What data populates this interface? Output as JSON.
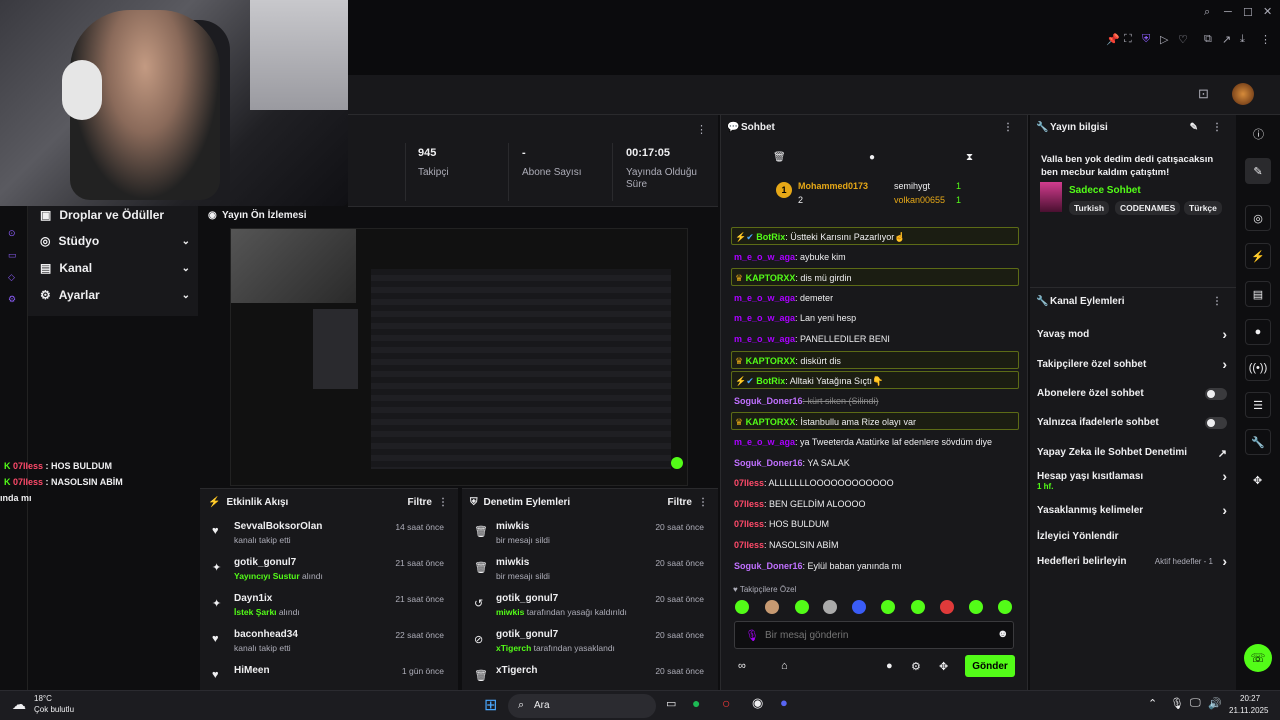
{
  "stats": [
    {
      "value": "945",
      "label": "Takipçi"
    },
    {
      "value": "-",
      "label": "Abone Sayısı"
    },
    {
      "value": "00:17:05",
      "label": "Yayında Olduğu Süre"
    }
  ],
  "leftmenu": [
    "Droplar ve Ödüller",
    "Stüdyo",
    "Kanal",
    "Ayarlar"
  ],
  "leftchat": [
    {
      "user": "07lless",
      "text": " : HOS BULDUM"
    },
    {
      "user": "07lless",
      "text": " : NASOLSIN ABİM"
    },
    {
      "user": "",
      "text": "ında mı"
    }
  ],
  "preview_title": "Yayın Ön İzlemesi",
  "activity": {
    "title": "Etkinlik Akışı",
    "filter": "Filtre",
    "rows": [
      {
        "name": "SevvalBoksorOlan",
        "desc": "kanalı takip etti",
        "hl": "",
        "time": "14 saat önce",
        "icon": "heart-icon"
      },
      {
        "name": "gotik_gonul7",
        "desc": " alındı",
        "hl": "Yayıncıyı Sustur",
        "time": "21 saat önce",
        "icon": "points-icon"
      },
      {
        "name": "Dayn1ix",
        "desc": " alındı",
        "hl": "İstek Şarkı",
        "time": "21 saat önce",
        "icon": "points-icon"
      },
      {
        "name": "baconhead34",
        "desc": "kanalı takip etti",
        "hl": "",
        "time": "22 saat önce",
        "icon": "heart-icon"
      },
      {
        "name": "HiMeen",
        "desc": "",
        "hl": "",
        "time": "1 gün önce",
        "icon": "heart-icon"
      }
    ]
  },
  "moderation": {
    "title": "Denetim Eylemleri",
    "filter": "Filtre",
    "rows": [
      {
        "name": "miwkis",
        "hl": "",
        "desc": "bir mesajı sildi",
        "time": "20 saat önce",
        "icon": "trash-icon"
      },
      {
        "name": "miwkis",
        "hl": "",
        "desc": "bir mesajı sildi",
        "time": "20 saat önce",
        "icon": "trash-icon"
      },
      {
        "name": "gotik_gonul7",
        "hl": "miwkis",
        "desc": " tarafından yasağı kaldırıldı",
        "time": "20 saat önce",
        "icon": "undo-icon"
      },
      {
        "name": "gotik_gonul7",
        "hl": "xTigerch",
        "desc": " tarafından yasaklandı",
        "time": "20 saat önce",
        "icon": "ban-icon"
      },
      {
        "name": "xTigerch",
        "hl": "",
        "desc": "",
        "time": "20 saat önce",
        "icon": "trash-icon"
      }
    ]
  },
  "chat": {
    "title": "Sohbet",
    "leaderboard": [
      {
        "name": "Mohammed0173",
        "count": "2"
      },
      {
        "name": "semihygt",
        "count": "1"
      },
      {
        "name": "volkan00655",
        "count": "1"
      }
    ],
    "messages": [
      {
        "user": "BotRix",
        "text": ": Üstteki Karısını Pazarlıyor☝",
        "color": "#53fc18",
        "hl": true
      },
      {
        "user": "m_e_o_w_aga",
        "text": ": aybuke kim",
        "color": "#a900ff",
        "hl": false
      },
      {
        "user": "KAPTORXX",
        "text": ": dis      mü girdin",
        "color": "#53fc18",
        "hl": true
      },
      {
        "user": "m_e_o_w_aga",
        "text": ": demeter",
        "color": "#a900ff",
        "hl": false
      },
      {
        "user": "m_e_o_w_aga",
        "text": ": Lan yeni hesp",
        "color": "#a900ff",
        "hl": false
      },
      {
        "user": "m_e_o_w_aga",
        "text": ": PANELLEDILER BENI",
        "color": "#a900ff",
        "hl": false
      },
      {
        "user": "KAPTORXX",
        "text": ": diskürt dis",
        "color": "#53fc18",
        "hl": true
      },
      {
        "user": "BotRix",
        "text": ": Alltaki Yatağına Sıçtı👇",
        "color": "#53fc18",
        "hl": true
      },
      {
        "user": "Soguk_Doner16",
        "text": ": kürt siken (Silindi)",
        "color": "#c070ff",
        "hl": false
      },
      {
        "user": "KAPTORXX",
        "text": ":      İstanbullu ama Rize olayı var",
        "color": "#53fc18",
        "hl": true
      },
      {
        "user": "m_e_o_w_aga",
        "text": ": ya Tweeterda Atatürke laf edenlere sövdüm diye",
        "color": "#a900ff",
        "hl": false
      },
      {
        "user": "Soguk_Doner16",
        "text": ": YA SALAK",
        "color": "#c070ff",
        "hl": false
      },
      {
        "user": "07lless",
        "text": ": ALLLLLLLOOOOOOOOOOOO",
        "color": "#ff4a6a",
        "hl": false
      },
      {
        "user": "07lless",
        "text": ": BEN GELDİM ALOOOO",
        "color": "#ff4a6a",
        "hl": false
      },
      {
        "user": "07lless",
        "text": ": HOS BULDUM",
        "color": "#ff4a6a",
        "hl": false
      },
      {
        "user": "07lless",
        "text": ": NASOLSIN ABİM",
        "color": "#ff4a6a",
        "hl": false
      },
      {
        "user": "Soguk_Doner16",
        "text": ": Eylül baban yanında mı",
        "color": "#c070ff",
        "hl": false
      }
    ],
    "followers_only": "Takipçilere Özel",
    "input_placeholder": "Bir mesaj gönderin",
    "send": "Gönder"
  },
  "stream_info": {
    "title": "Yayın bilgisi",
    "stream_title": "Valla ben yok dedim dedi çatışacaksın ben mecbur kaldım çatıştım!",
    "category": "Sadece Sohbet",
    "tags": [
      "Turkish",
      "CODENAMES",
      "Türkçe"
    ]
  },
  "channel_actions": {
    "title": "Kanal Eylemleri",
    "items": [
      {
        "label": "Yavaş mod",
        "type": "arrow"
      },
      {
        "label": "Takipçilere özel sohbet",
        "type": "arrow"
      },
      {
        "label": "Abonelere özel sohbet",
        "type": "toggle"
      },
      {
        "label": "Yalnızca ifadelerle sohbet",
        "type": "toggle"
      },
      {
        "label": "Yapay Zeka ile Sohbet Denetimi",
        "type": "ext"
      },
      {
        "label": "Hesap yaşı kısıtlaması",
        "type": "arrow",
        "sub": "1 hf."
      },
      {
        "label": "Yasaklanmış kelimeler",
        "type": "arrow"
      },
      {
        "label": "İzleyici Yönlendir",
        "type": "none"
      },
      {
        "label": "Hedefleri belirleyin",
        "type": "arrow",
        "extra": "Aktif hedefler - 1"
      }
    ]
  },
  "taskbar": {
    "weather_temp": "18°C",
    "weather_desc": "Çok bulutlu",
    "search": "Ara",
    "time": "20:27",
    "date": "21.11.2025"
  },
  "colors": {
    "accent": "#53fc18",
    "bg": "#0e0e10",
    "panel": "#18181b"
  }
}
